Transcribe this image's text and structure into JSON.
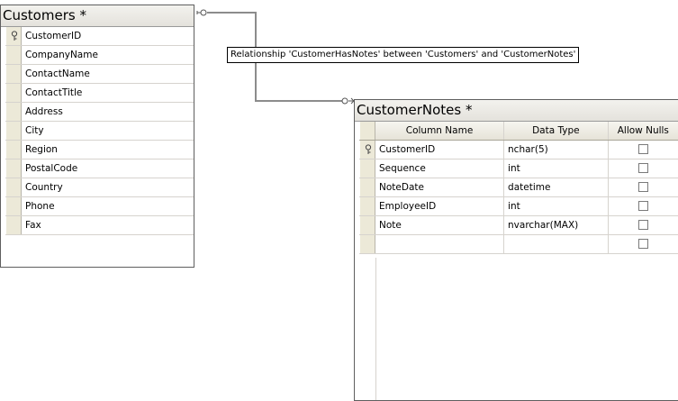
{
  "customers": {
    "title": "Customers *",
    "columns": [
      "CustomerID",
      "CompanyName",
      "ContactName",
      "ContactTitle",
      "Address",
      "City",
      "Region",
      "PostalCode",
      "Country",
      "Phone",
      "Fax"
    ]
  },
  "relationship": {
    "tooltip": "Relationship 'CustomerHasNotes' between 'Customers' and 'CustomerNotes'"
  },
  "customer_notes": {
    "title": "CustomerNotes *",
    "headers": {
      "column_name": "Column Name",
      "data_type": "Data Type",
      "allow_nulls": "Allow Nulls"
    },
    "rows": [
      {
        "name": "CustomerID",
        "type": "nchar(5)",
        "allow_nulls": false
      },
      {
        "name": "Sequence",
        "type": "int",
        "allow_nulls": false
      },
      {
        "name": "NoteDate",
        "type": "datetime",
        "allow_nulls": false
      },
      {
        "name": "EmployeeID",
        "type": "int",
        "allow_nulls": false
      },
      {
        "name": "Note",
        "type": "nvarchar(MAX)",
        "allow_nulls": false
      },
      {
        "name": "",
        "type": "",
        "allow_nulls": false
      }
    ]
  }
}
